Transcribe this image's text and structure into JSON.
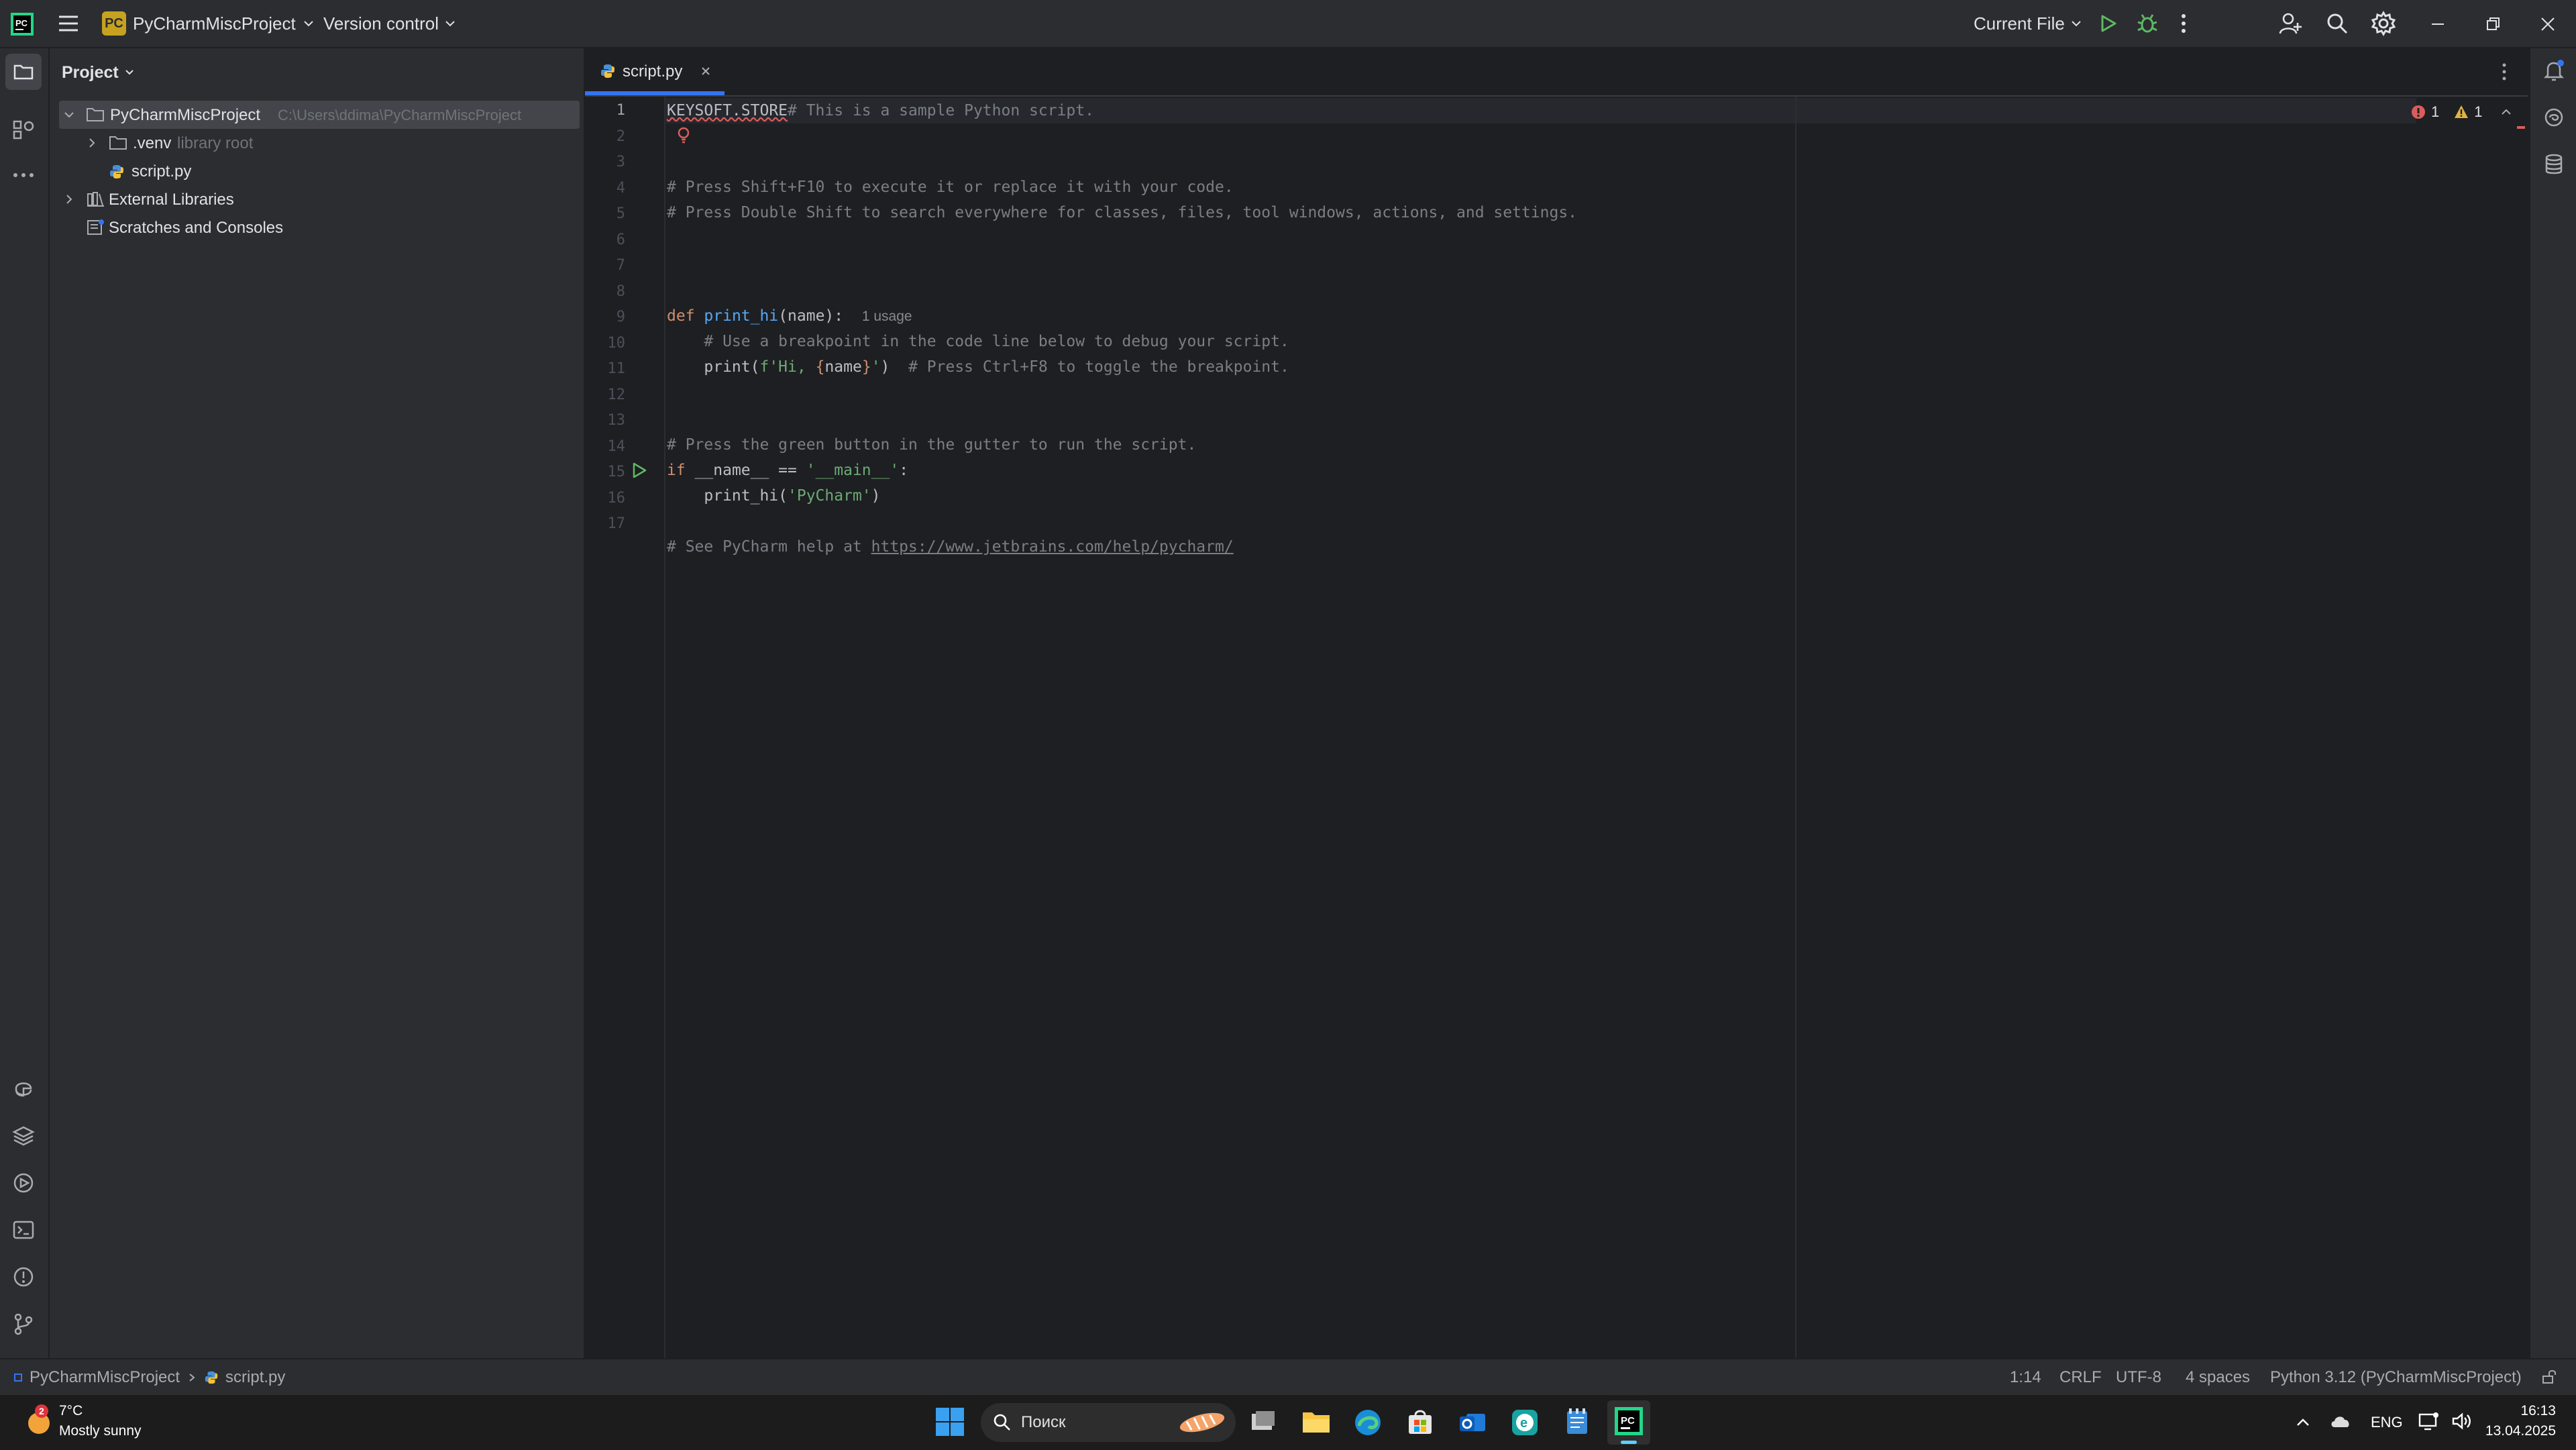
{
  "titlebar": {
    "project_badge": "PC",
    "project_name": "PyCharmMiscProject",
    "vcs": "Version control",
    "run_config": "Current File"
  },
  "project_panel": {
    "title": "Project",
    "root": {
      "label": "PyCharmMiscProject",
      "path": "C:\\Users\\ddima\\PyCharmMiscProject"
    },
    "venv": {
      "label": ".venv",
      "hint": "library root"
    },
    "script": {
      "label": "script.py"
    },
    "external": {
      "label": "External Libraries"
    },
    "scratches": {
      "label": "Scratches and Consoles"
    }
  },
  "editor": {
    "tab_label": "script.py",
    "inspections": {
      "errors": "1",
      "warnings": "1"
    },
    "line_numbers": [
      "1",
      "2",
      "3",
      "4",
      "5",
      "6",
      "7",
      "8",
      "9",
      "10",
      "11",
      "12",
      "13",
      "14",
      "15",
      "16",
      "17"
    ],
    "code": {
      "l1_a": "KEYSOFT.STORE",
      "l1_b": "# This is a sample Python script.",
      "l3": "# Press Shift+F10 to execute it or replace it with your code.",
      "l4": "# Press Double Shift to search everywhere for classes, files, tool windows, actions, and settings.",
      "l7_kw": "def",
      "l7_fn": "print_hi",
      "l7_args": "(name):",
      "l7_hint": "1 usage",
      "l8": "# Use a breakpoint in the code line below to debug your script.",
      "l9_a": "print(",
      "l9_b": "f'Hi, ",
      "l9_c": "{",
      "l9_d": "name",
      "l9_e": "}",
      "l9_f": "'",
      "l9_g": ")",
      "l9_h": "  # Press Ctrl+F8 to toggle the breakpoint.",
      "l12": "# Press the green button in the gutter to run the script.",
      "l13_kw": "if",
      "l13_a": " __name__ == ",
      "l13_str": "'__main__'",
      "l13_b": ":",
      "l14_a": "print_hi(",
      "l14_str": "'PyCharm'",
      "l14_b": ")",
      "l16_a": "# See PyCharm help at ",
      "l16_link": "https://www.jetbrains.com/help/pycharm/"
    }
  },
  "statusbar": {
    "breadcrumb_project": "PyCharmMiscProject",
    "breadcrumb_file": "script.py",
    "position": "1:14",
    "line_sep": "CRLF",
    "encoding": "UTF-8",
    "indent": "4 spaces",
    "interpreter": "Python 3.12 (PyCharmMiscProject)"
  },
  "taskbar": {
    "weather_badge": "2",
    "temp": "7°C",
    "weather": "Mostly sunny",
    "search_placeholder": "Поиск",
    "lang": "ENG",
    "time": "16:13",
    "date": "13.04.2025"
  },
  "colors": {
    "accent": "#3574f0",
    "run_green": "#5fb865",
    "error_red": "#db5c5c",
    "warning_yellow": "#e0b345"
  }
}
